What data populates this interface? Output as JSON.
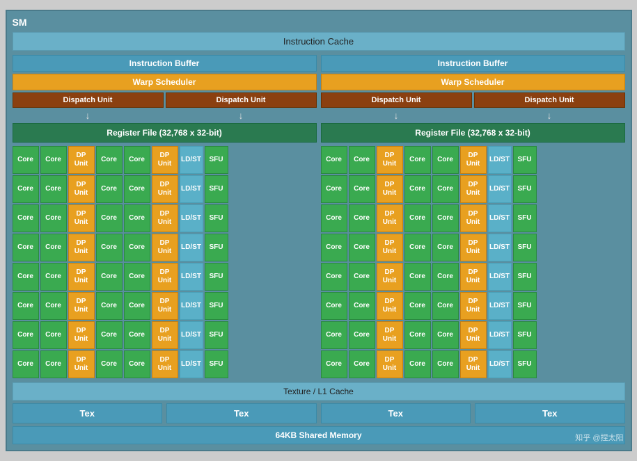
{
  "sm": {
    "label": "SM",
    "instruction_cache": "Instruction Cache",
    "left": {
      "instruction_buffer": "Instruction Buffer",
      "warp_scheduler": "Warp Scheduler",
      "dispatch_unit1": "Dispatch Unit",
      "dispatch_unit2": "Dispatch Unit",
      "register_file": "Register File (32,768 x 32-bit)"
    },
    "right": {
      "instruction_buffer": "Instruction Buffer",
      "warp_scheduler": "Warp Scheduler",
      "dispatch_unit1": "Dispatch Unit",
      "dispatch_unit2": "Dispatch Unit",
      "register_file": "Register File (32,768 x 32-bit)"
    },
    "core_label": "Core",
    "dp_label": "DP\nUnit",
    "ldst_label": "LD/ST",
    "sfu_label": "SFU",
    "texture_cache": "Texture / L1 Cache",
    "tex_label": "Tex",
    "shared_memory": "64KB Shared Memory",
    "watermark": "知乎 @捏太阳",
    "rows": 8
  }
}
